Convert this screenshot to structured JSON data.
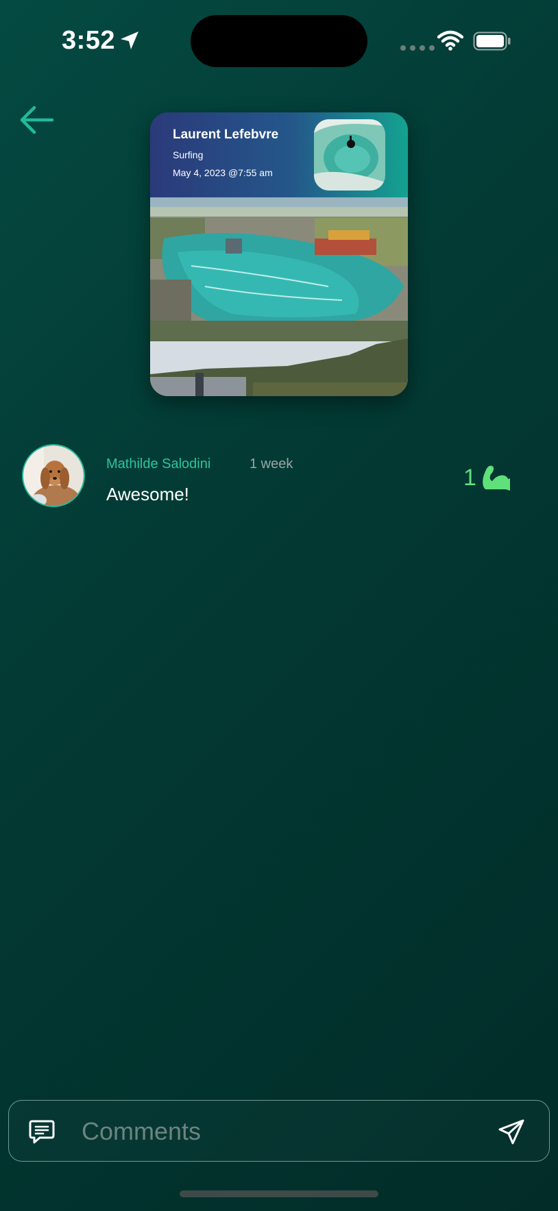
{
  "status_bar": {
    "time": "3:52"
  },
  "post": {
    "author": "Laurent Lefebvre",
    "sport": "Surfing",
    "date": "May 4, 2023 @7:55 am"
  },
  "comments": [
    {
      "author": "Mathilde Salodini",
      "time": "1 week",
      "text": "Awesome!",
      "likes": "1"
    }
  ],
  "composer": {
    "placeholder": "Comments"
  },
  "colors": {
    "accent": "#2ec4a0",
    "like": "#5fe07a",
    "background": "#033a34"
  },
  "icons": [
    "location-arrow-icon",
    "wifi-icon",
    "battery-icon",
    "back-arrow-icon",
    "flexed-bicep-icon",
    "chat-bubble-icon",
    "send-icon"
  ]
}
